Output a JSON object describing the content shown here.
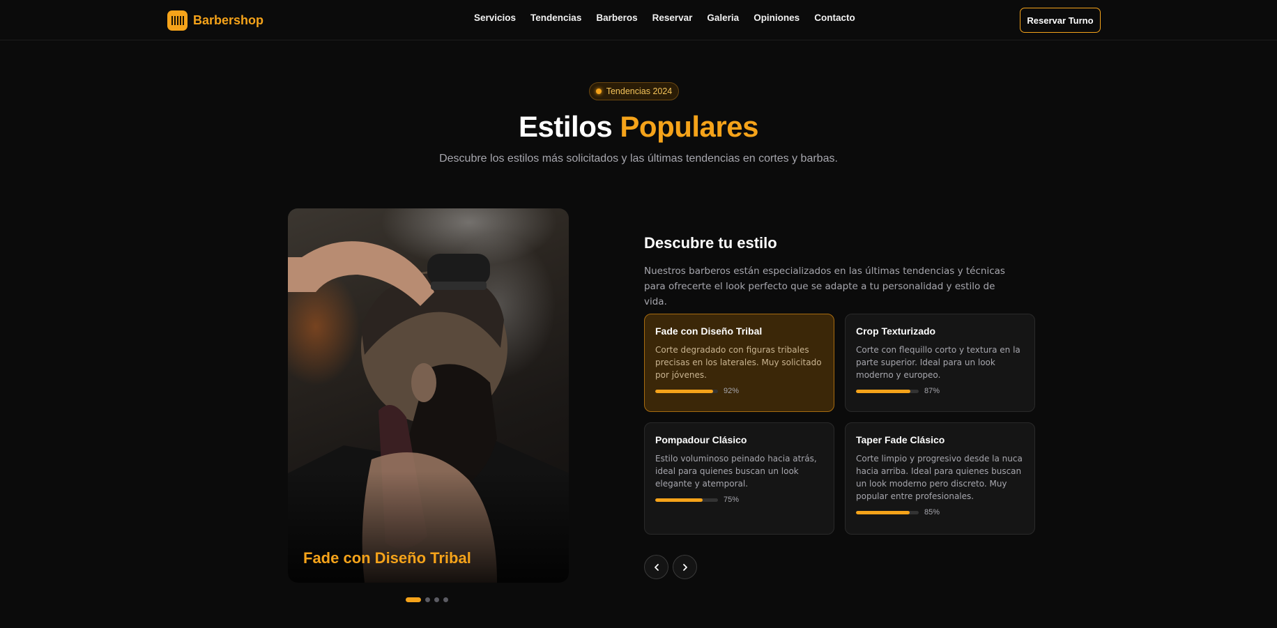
{
  "nav": {
    "brand": "Barbershop",
    "brand_icon": "barber-pole-icon",
    "items": [
      "Servicios",
      "Tendencias",
      "Barberos",
      "Reservar",
      "Galeria",
      "Opiniones",
      "Contacto"
    ],
    "cta": "Reservar Turno"
  },
  "hero": {
    "badge": "Tendencias 2024",
    "title_plain": "Estilos",
    "title_accent": "Populares",
    "subtitle": "Descubre los estilos más solicitados y las últimas tendencias en cortes y barbas.",
    "accent_color": "#f5a31a"
  },
  "photo": {
    "caption": "Fade con Diseño Tribal",
    "slides_total": 4,
    "active_slide": 1
  },
  "section": {
    "title": "Descubre tu estilo",
    "description": "Nuestros barberos están especializados en las últimas tendencias y técnicas para ofrecerte el look perfecto que se adapte a tu personalidad y estilo de vida."
  },
  "styles": [
    {
      "title": "Fade con Diseño Tribal",
      "description": "Corte degradado con figuras tribales precisas en los laterales. Muy solicitado por jóvenes.",
      "popularity": 92,
      "popularity_label": "92%",
      "active": true
    },
    {
      "title": "Crop Texturizado",
      "description": "Corte con flequillo corto y textura en la parte superior. Ideal para un look moderno y europeo.",
      "popularity": 87,
      "popularity_label": "87%",
      "active": false
    },
    {
      "title": "Pompadour Clásico",
      "description": "Estilo voluminoso peinado hacia atrás, ideal para quienes buscan un look elegante y atemporal.",
      "popularity": 75,
      "popularity_label": "75%",
      "active": false
    },
    {
      "title": "Taper Fade Clásico",
      "description": "Corte limpio y progresivo desde la nuca hacia arriba. Ideal para quienes buscan un look moderno pero discreto. Muy popular entre profesionales.",
      "popularity": 85,
      "popularity_label": "85%",
      "active": false
    }
  ],
  "controls": {
    "prev_icon": "chevron-left-icon",
    "next_icon": "chevron-right-icon"
  }
}
